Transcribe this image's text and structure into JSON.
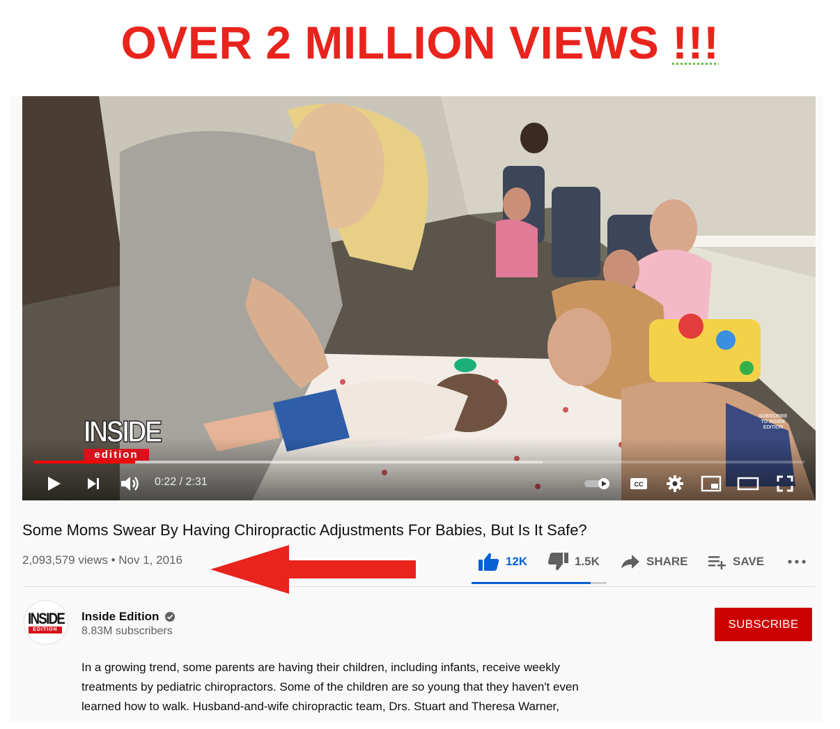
{
  "headline": {
    "text": "OVER 2 MILLION VIEWS",
    "bangs": "!!!"
  },
  "video": {
    "time_display": "0:22 / 2:31",
    "progress_fraction": 0.132,
    "buffered_fraction": 0.66,
    "watermark_logo": "INSIDE",
    "watermark_sub": "edition",
    "subscribe_watermark": "SUBSCRIBE TO INSIDE EDITION"
  },
  "info": {
    "title": "Some Moms Swear By Having Chiropractic Adjustments For Babies, But Is It Safe?",
    "meta": "2,093,579 views • Nov 1, 2016"
  },
  "actions": {
    "like_count": "12K",
    "dislike_count": "1.5K",
    "share_label": "SHARE",
    "save_label": "SAVE",
    "like_ratio": 0.88,
    "like_color": "#065fd4"
  },
  "channel": {
    "name": "Inside Edition",
    "subscribers": "8.83M subscribers",
    "avatar_word": "INSIDE",
    "avatar_sub": "EDITION",
    "subscribe_label": "SUBSCRIBE",
    "subscribe_color": "#cc0000"
  },
  "description": {
    "lines": [
      "In a growing trend, some parents are having their children, including infants, receive weekly",
      "treatments by pediatric chiropractors. Some of the children are so young that they haven't even",
      "learned how to walk. Husband-and-wife chiropractic team, Drs. Stuart and Theresa Warner,"
    ]
  },
  "annotation": {
    "arrow_color": "#e8241d",
    "headline_color": "#e8241d"
  }
}
